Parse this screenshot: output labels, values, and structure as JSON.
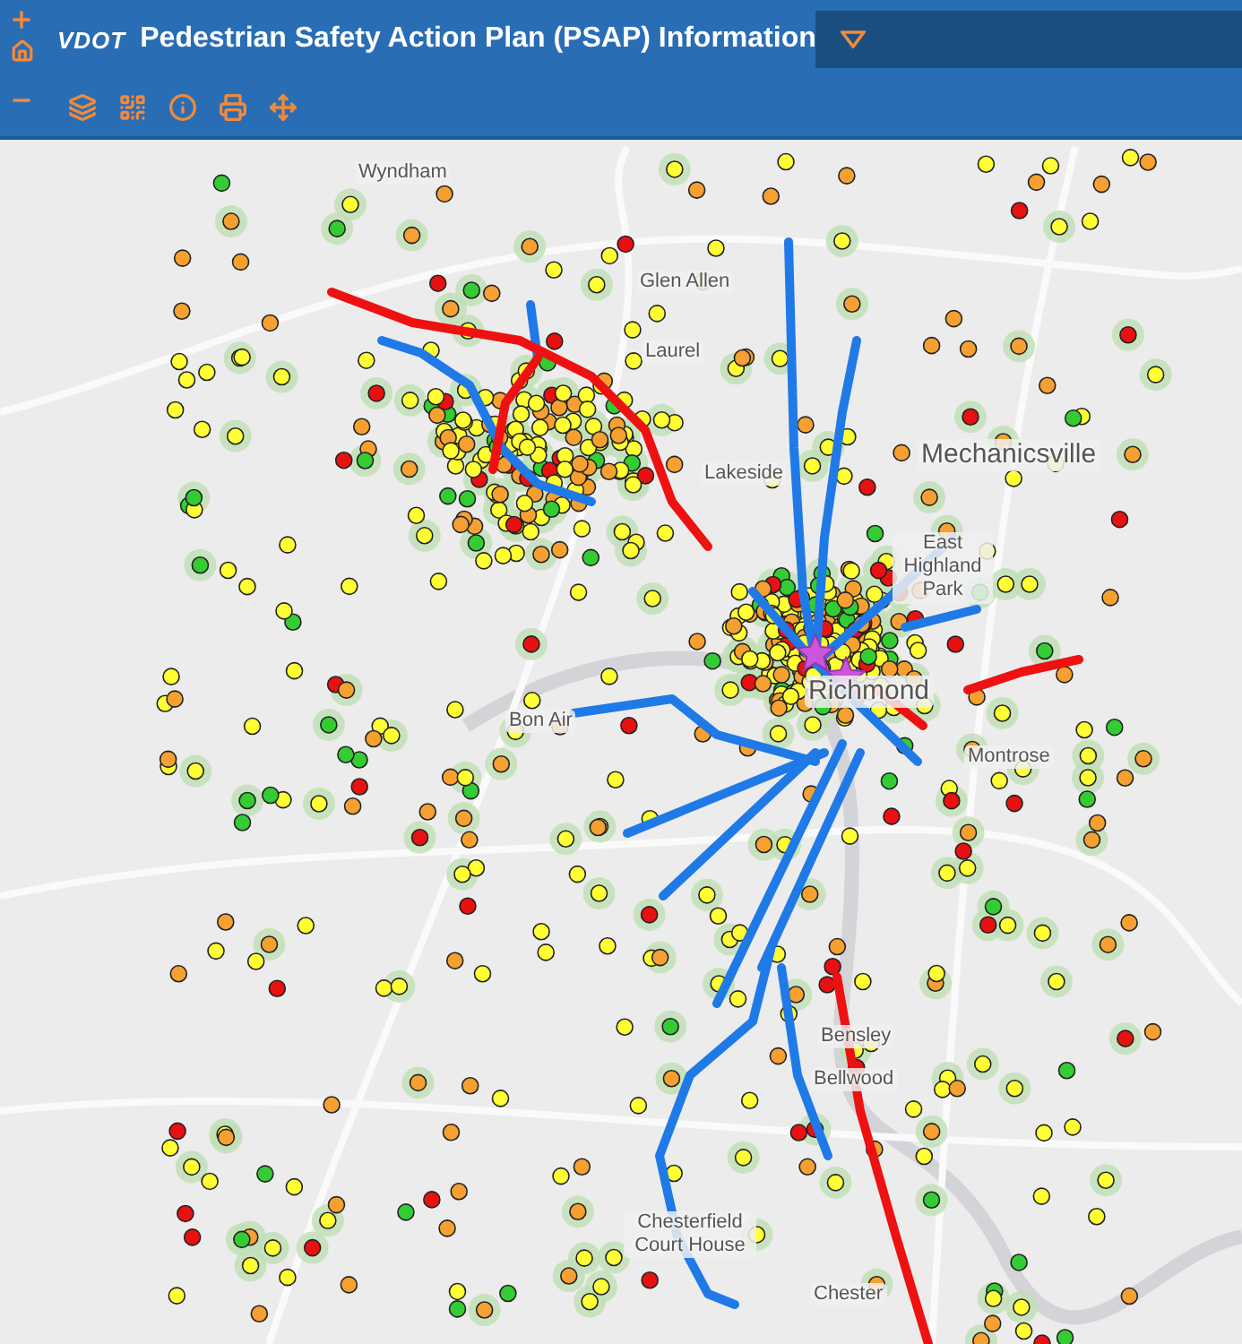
{
  "header": {
    "logo": "VDOT",
    "title": "Pedestrian Safety Action Plan (PSAP) Information"
  },
  "map": {
    "labels": [
      {
        "text": "Wyndham",
        "kind": "town"
      },
      {
        "text": "Glen Allen",
        "kind": "town"
      },
      {
        "text": "Laurel",
        "kind": "town"
      },
      {
        "text": "Lakeside",
        "kind": "town"
      },
      {
        "text": "Mechanicsville",
        "kind": "city"
      },
      {
        "text": "East Highland Park",
        "kind": "town"
      },
      {
        "text": "Richmond",
        "kind": "city"
      },
      {
        "text": "Bon Air",
        "kind": "town"
      },
      {
        "text": "Montrose",
        "kind": "town"
      },
      {
        "text": "Bensley",
        "kind": "town"
      },
      {
        "text": "Bellwood",
        "kind": "town"
      },
      {
        "text": "Chesterfield Court House",
        "kind": "town"
      },
      {
        "text": "Chester",
        "kind": "town"
      }
    ]
  }
}
